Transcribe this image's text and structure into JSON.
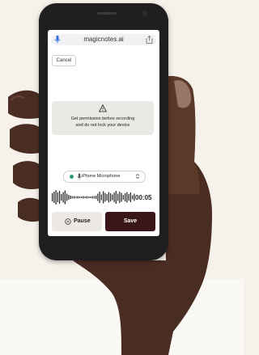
{
  "browser": {
    "url": "magicnotes.ai"
  },
  "header": {
    "cancel_label": "Cancel"
  },
  "warning": {
    "line1": "Get permission before recording",
    "line2": "and do not lock your device"
  },
  "microphone": {
    "selected": "iPhone Microphone",
    "status_color": "#2d9a6b"
  },
  "recording": {
    "timer": "00:05"
  },
  "controls": {
    "pause_label": "Pause",
    "save_label": "Save",
    "save_color": "#3b1619"
  },
  "icons": [
    "microphone-icon",
    "share-icon",
    "warning-icon",
    "chevron-icon",
    "pause-icon"
  ]
}
